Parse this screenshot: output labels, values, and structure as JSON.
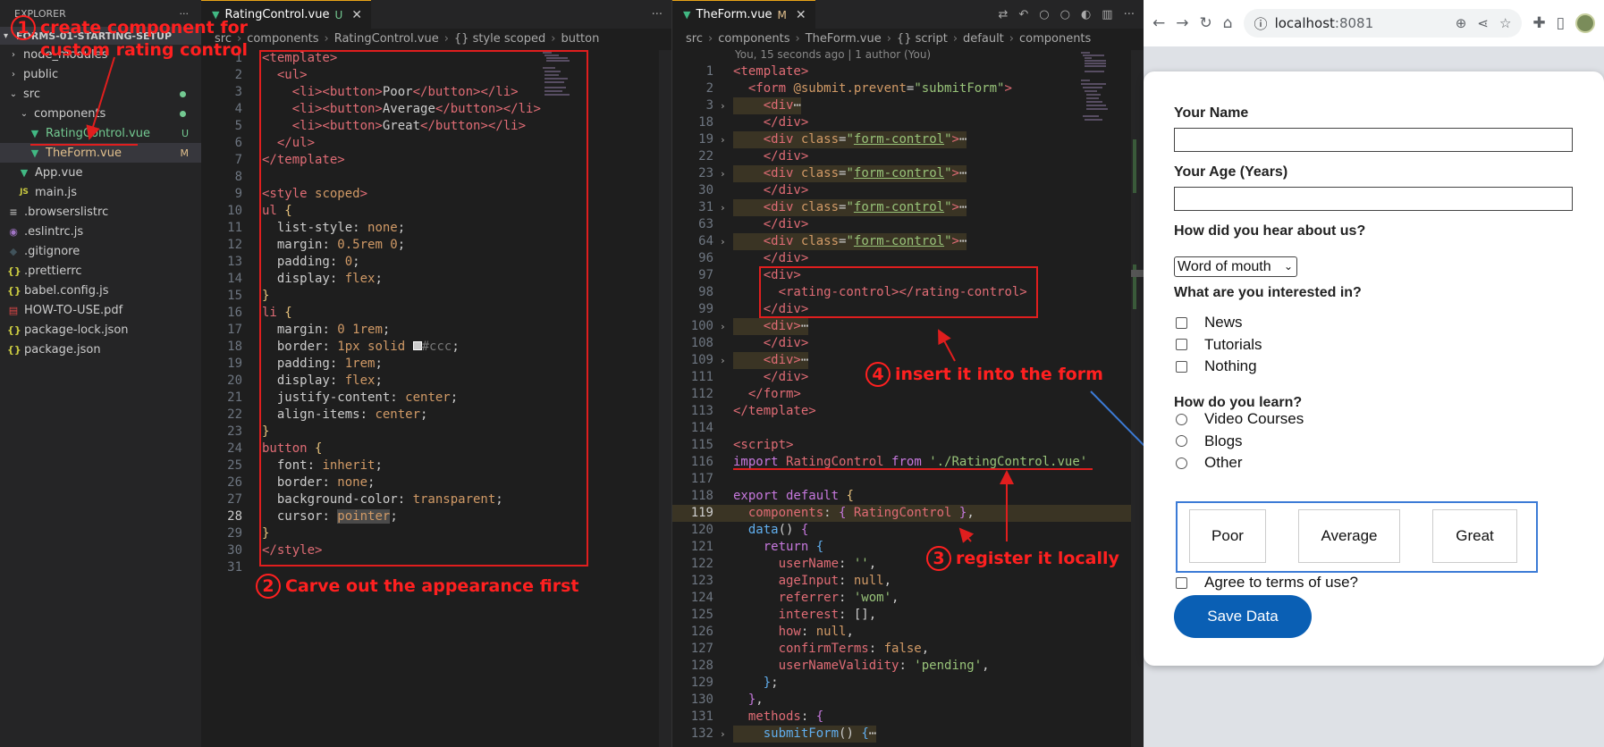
{
  "explorer": {
    "title": "EXPLORER",
    "more": "···",
    "project": "FORMS-01-STARTING-SETUP",
    "items": [
      {
        "label": "node_modules",
        "kind": "folder",
        "open": false,
        "indent": 0,
        "badge": ""
      },
      {
        "label": "public",
        "kind": "folder",
        "open": false,
        "indent": 0,
        "badge": ""
      },
      {
        "label": "src",
        "kind": "folder",
        "open": true,
        "indent": 0,
        "badge": "dot"
      },
      {
        "label": "components",
        "kind": "folder",
        "open": true,
        "indent": 1,
        "badge": "dot"
      },
      {
        "label": "RatingControl.vue",
        "kind": "vue",
        "indent": 2,
        "badge": "U",
        "color": "#73c991",
        "selected": false
      },
      {
        "label": "TheForm.vue",
        "kind": "vue",
        "indent": 2,
        "badge": "M",
        "color": "#e2c08d",
        "selected": true
      },
      {
        "label": "App.vue",
        "kind": "vue",
        "indent": 1,
        "badge": ""
      },
      {
        "label": "main.js",
        "kind": "js",
        "indent": 1,
        "badge": ""
      },
      {
        "label": ".browserslistrc",
        "kind": "list",
        "indent": 0,
        "badge": ""
      },
      {
        "label": ".eslintrc.js",
        "kind": "eslint",
        "indent": 0,
        "badge": ""
      },
      {
        "label": ".gitignore",
        "kind": "git",
        "indent": 0,
        "badge": ""
      },
      {
        "label": ".prettierrc",
        "kind": "json",
        "indent": 0,
        "badge": ""
      },
      {
        "label": "babel.config.js",
        "kind": "babel",
        "indent": 0,
        "badge": ""
      },
      {
        "label": "HOW-TO-USE.pdf",
        "kind": "pdf",
        "indent": 0,
        "badge": ""
      },
      {
        "label": "package-lock.json",
        "kind": "json",
        "indent": 0,
        "badge": ""
      },
      {
        "label": "package.json",
        "kind": "json",
        "indent": 0,
        "badge": ""
      }
    ]
  },
  "editor1": {
    "tab": "RatingControl.vue",
    "tab_status": "U",
    "more": "···",
    "crumbs": [
      "src",
      "components",
      "RatingControl.vue",
      "{} style scoped",
      "button"
    ],
    "lines": [
      {
        "n": "1",
        "h": "<span class='tg'>&lt;template&gt;</span>"
      },
      {
        "n": "2",
        "h": "  <span class='tg'>&lt;ul&gt;</span>"
      },
      {
        "n": "3",
        "h": "    <span class='tg'>&lt;li&gt;&lt;button&gt;</span>Poor<span class='tg'>&lt;/button&gt;&lt;/li&gt;</span>"
      },
      {
        "n": "4",
        "h": "    <span class='tg'>&lt;li&gt;&lt;button&gt;</span>Average<span class='tg'>&lt;/button&gt;&lt;/li&gt;</span>"
      },
      {
        "n": "5",
        "h": "    <span class='tg'>&lt;li&gt;&lt;button&gt;</span>Great<span class='tg'>&lt;/button&gt;&lt;/li&gt;</span>"
      },
      {
        "n": "6",
        "h": "  <span class='tg'>&lt;/ul&gt;</span>"
      },
      {
        "n": "7",
        "h": "<span class='tg'>&lt;/template&gt;</span>"
      },
      {
        "n": "8",
        "h": ""
      },
      {
        "n": "9",
        "h": "<span class='tg'>&lt;style</span> <span class='at'>scoped</span><span class='tg'>&gt;</span>"
      },
      {
        "n": "10",
        "h": "<span class='tg'>ul</span> <span class='ye'>{</span>"
      },
      {
        "n": "11",
        "h": "  <span class='pc'>list-style</span>: <span class='vl'>none</span>;"
      },
      {
        "n": "12",
        "h": "  <span class='pc'>margin</span>: <span class='vl'>0.5rem 0</span>;"
      },
      {
        "n": "13",
        "h": "  <span class='pc'>padding</span>: <span class='vl'>0</span>;"
      },
      {
        "n": "14",
        "h": "  <span class='pc'>display</span>: <span class='vl'>flex</span>;"
      },
      {
        "n": "15",
        "h": "<span class='ye'>}</span>"
      },
      {
        "n": "16",
        "h": "<span class='tg'>li</span> <span class='ye'>{</span>"
      },
      {
        "n": "17",
        "h": "  <span class='pc'>margin</span>: <span class='vl'>0 1rem</span>;"
      },
      {
        "n": "18",
        "h": "  <span class='pc'>border</span>: <span class='vl'>1px solid</span> <span style='display:inline-block;width:10px;height:10px;background:#ccc;border:1px solid #fff'></span><span class='vl' style='color:#777'>#ccc</span>;"
      },
      {
        "n": "19",
        "h": "  <span class='pc'>padding</span>: <span class='vl'>1rem</span>;"
      },
      {
        "n": "20",
        "h": "  <span class='pc'>display</span>: <span class='vl'>flex</span>;"
      },
      {
        "n": "21",
        "h": "  <span class='pc'>justify-content</span>: <span class='vl'>center</span>;"
      },
      {
        "n": "22",
        "h": "  <span class='pc'>align-items</span>: <span class='vl'>center</span>;"
      },
      {
        "n": "23",
        "h": "<span class='ye'>}</span>"
      },
      {
        "n": "24",
        "h": "<span class='tg'>button</span> <span class='ye'>{</span>"
      },
      {
        "n": "25",
        "h": "  <span class='pc'>font</span>: <span class='vl'>inherit</span>;"
      },
      {
        "n": "26",
        "h": "  <span class='pc'>border</span>: <span class='vl'>none</span>;"
      },
      {
        "n": "27",
        "h": "  <span class='pc'>background-color</span>: <span class='vl'>transparent</span>;"
      },
      {
        "n": "28",
        "h": "  <span class='pc'>cursor</span>: <span class='vl' style='background:#4a4a4a'>pointer</span>;",
        "cur": true
      },
      {
        "n": "29",
        "h": "<span class='ye'>}</span>"
      },
      {
        "n": "30",
        "h": "<span class='tg'>&lt;/style&gt;</span>"
      },
      {
        "n": "31",
        "h": ""
      }
    ]
  },
  "editor2": {
    "tab": "TheForm.vue",
    "tab_status": "M",
    "crumbs": [
      "src",
      "components",
      "TheForm.vue",
      "{} script",
      "default",
      "components"
    ],
    "blame": "You, 15 seconds ago | 1 author (You)",
    "lines": [
      {
        "n": "1",
        "h": "<span class='tg'>&lt;template&gt;</span>"
      },
      {
        "n": "2",
        "h": "  <span class='tg'>&lt;form</span> <span class='at'>@submit.prevent</span>=<span class='st'>\"submitForm\"</span><span class='tg'>&gt;</span>"
      },
      {
        "n": "3",
        "h": "    <span class='tg'>&lt;div</span><span class='pc'>⋯</span>",
        "fold": true
      },
      {
        "n": "18",
        "h": "    <span class='tg'>&lt;/div&gt;</span>"
      },
      {
        "n": "19",
        "h": "    <span class='tg'>&lt;div</span> <span class='at'>class</span>=<span class='st'>\"<u>form-control</u>\"</span><span class='tg'>&gt;</span><span class='pc'>⋯</span>",
        "fold": true
      },
      {
        "n": "22",
        "h": "    <span class='tg'>&lt;/div&gt;</span>"
      },
      {
        "n": "23",
        "h": "    <span class='tg'>&lt;div</span> <span class='at'>class</span>=<span class='st'>\"<u>form-control</u>\"</span><span class='tg'>&gt;</span><span class='pc'>⋯</span>",
        "fold": true
      },
      {
        "n": "30",
        "h": "    <span class='tg'>&lt;/div&gt;</span>"
      },
      {
        "n": "31",
        "h": "    <span class='tg'>&lt;div</span> <span class='at'>class</span>=<span class='st'>\"<u>form-control</u>\"</span><span class='tg'>&gt;</span><span class='pc'>⋯</span>",
        "fold": true
      },
      {
        "n": "63",
        "h": "    <span class='tg'>&lt;/div&gt;</span>"
      },
      {
        "n": "64",
        "h": "    <span class='tg'>&lt;div</span> <span class='at'>class</span>=<span class='st'>\"<u>form-control</u>\"</span><span class='tg'>&gt;</span><span class='pc'>⋯</span>",
        "fold": true
      },
      {
        "n": "96",
        "h": "    <span class='tg'>&lt;/div&gt;</span>"
      },
      {
        "n": "97",
        "h": "    <span class='tg'>&lt;div&gt;</span>"
      },
      {
        "n": "98",
        "h": "      <span class='tg'>&lt;rating-control&gt;&lt;/rating-control&gt;</span>"
      },
      {
        "n": "99",
        "h": "    <span class='tg'>&lt;/div&gt;</span>"
      },
      {
        "n": "100",
        "h": "    <span class='tg'>&lt;div&gt;</span><span class='pc'>⋯</span>",
        "fold": true
      },
      {
        "n": "108",
        "h": "    <span class='tg'>&lt;/div&gt;</span>"
      },
      {
        "n": "109",
        "h": "    <span class='tg'>&lt;div&gt;</span><span class='pc'>⋯</span>",
        "fold": true
      },
      {
        "n": "111",
        "h": "    <span class='tg'>&lt;/div&gt;</span>"
      },
      {
        "n": "112",
        "h": "  <span class='tg'>&lt;/form&gt;</span>"
      },
      {
        "n": "113",
        "h": "<span class='tg'>&lt;/template&gt;</span>"
      },
      {
        "n": "114",
        "h": ""
      },
      {
        "n": "115",
        "h": "<span class='tg'>&lt;script&gt;</span>"
      },
      {
        "n": "116",
        "h": "<span class='kw'>import</span> <span class='pr'>RatingControl</span> <span class='kw'>from</span> <span class='st'>'./RatingControl.vue'</span>"
      },
      {
        "n": "117",
        "h": ""
      },
      {
        "n": "118",
        "h": "<span class='kw'>export default</span> <span class='ye'>{</span>"
      },
      {
        "n": "119",
        "h": "  <span class='pr'>components</span>: <span class='kw'>{</span> <span class='pr'>RatingControl</span> <span class='kw'>}</span>,",
        "cur": true,
        "hl": true
      },
      {
        "n": "120",
        "h": "  <span class='fn'>data</span>() <span class='kw'>{</span>"
      },
      {
        "n": "121",
        "h": "    <span class='kw'>return</span> <span class='fn'>{</span>"
      },
      {
        "n": "122",
        "h": "      <span class='pr'>userName</span>: <span class='st'>''</span>,"
      },
      {
        "n": "123",
        "h": "      <span class='pr'>ageInput</span>: <span class='vl'>null</span>,"
      },
      {
        "n": "124",
        "h": "      <span class='pr'>referrer</span>: <span class='st'>'wom'</span>,"
      },
      {
        "n": "125",
        "h": "      <span class='pr'>interest</span>: [],"
      },
      {
        "n": "126",
        "h": "      <span class='pr'>how</span>: <span class='vl'>null</span>,"
      },
      {
        "n": "127",
        "h": "      <span class='pr'>confirmTerms</span>: <span class='vl'>false</span>,"
      },
      {
        "n": "128",
        "h": "      <span class='pr'>userNameValidity</span>: <span class='st'>'pending'</span>,"
      },
      {
        "n": "129",
        "h": "    <span class='fn'>}</span>;"
      },
      {
        "n": "130",
        "h": "  <span class='kw'>}</span>,"
      },
      {
        "n": "131",
        "h": "  <span class='pr'>methods</span>: <span class='kw'>{</span>"
      },
      {
        "n": "132",
        "h": "    <span class='fn'>submitForm</span>() <span class='fn'>{</span><span class='pc'>⋯</span>",
        "fold": true
      }
    ]
  },
  "annotations": {
    "a1_num": "1",
    "a1_line1": "create component for",
    "a1_line2": "custom rating control",
    "a2_num": "2",
    "a2_text": "Carve out the appearance first",
    "a3_num": "3",
    "a3_text": "register it locally",
    "a4_num": "4",
    "a4_text": "insert it into the form"
  },
  "browser": {
    "url_host": "localhost",
    "url_port": ":8081"
  },
  "form": {
    "name_label": "Your Name",
    "age_label": "Your Age (Years)",
    "referrer_label": "How did you hear about us?",
    "referrer_value": "Word of mouth",
    "interest_label": "What are you interested in?",
    "interests": [
      "News",
      "Tutorials",
      "Nothing"
    ],
    "learn_label": "How do you learn?",
    "learn_options": [
      "Video Courses",
      "Blogs",
      "Other"
    ],
    "rating_options": [
      "Poor",
      "Average",
      "Great"
    ],
    "terms_label": "Agree to terms of use?",
    "save_label": "Save Data"
  },
  "colors": {
    "annotation_red": "#e01e1e",
    "rating_box_blue": "#3c7bd6",
    "save_button": "#0a5fb4"
  }
}
